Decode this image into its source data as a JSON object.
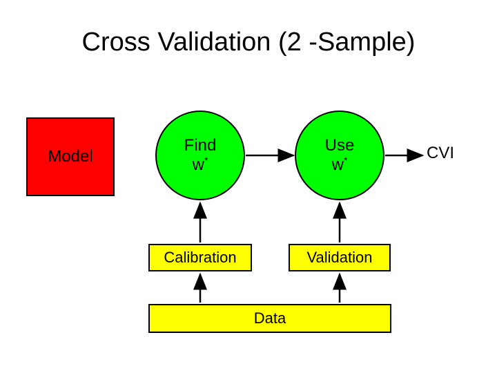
{
  "title": "Cross Validation (2 -Sample)",
  "model": {
    "label": "Model"
  },
  "find": {
    "line1": "Find",
    "line2_base": "w",
    "line2_sup": "*"
  },
  "use": {
    "line1": "Use",
    "line2_base": "w",
    "line2_sup": "*"
  },
  "cvi": "CVI",
  "calibration": "Calibration",
  "validation": "Validation",
  "data": "Data"
}
